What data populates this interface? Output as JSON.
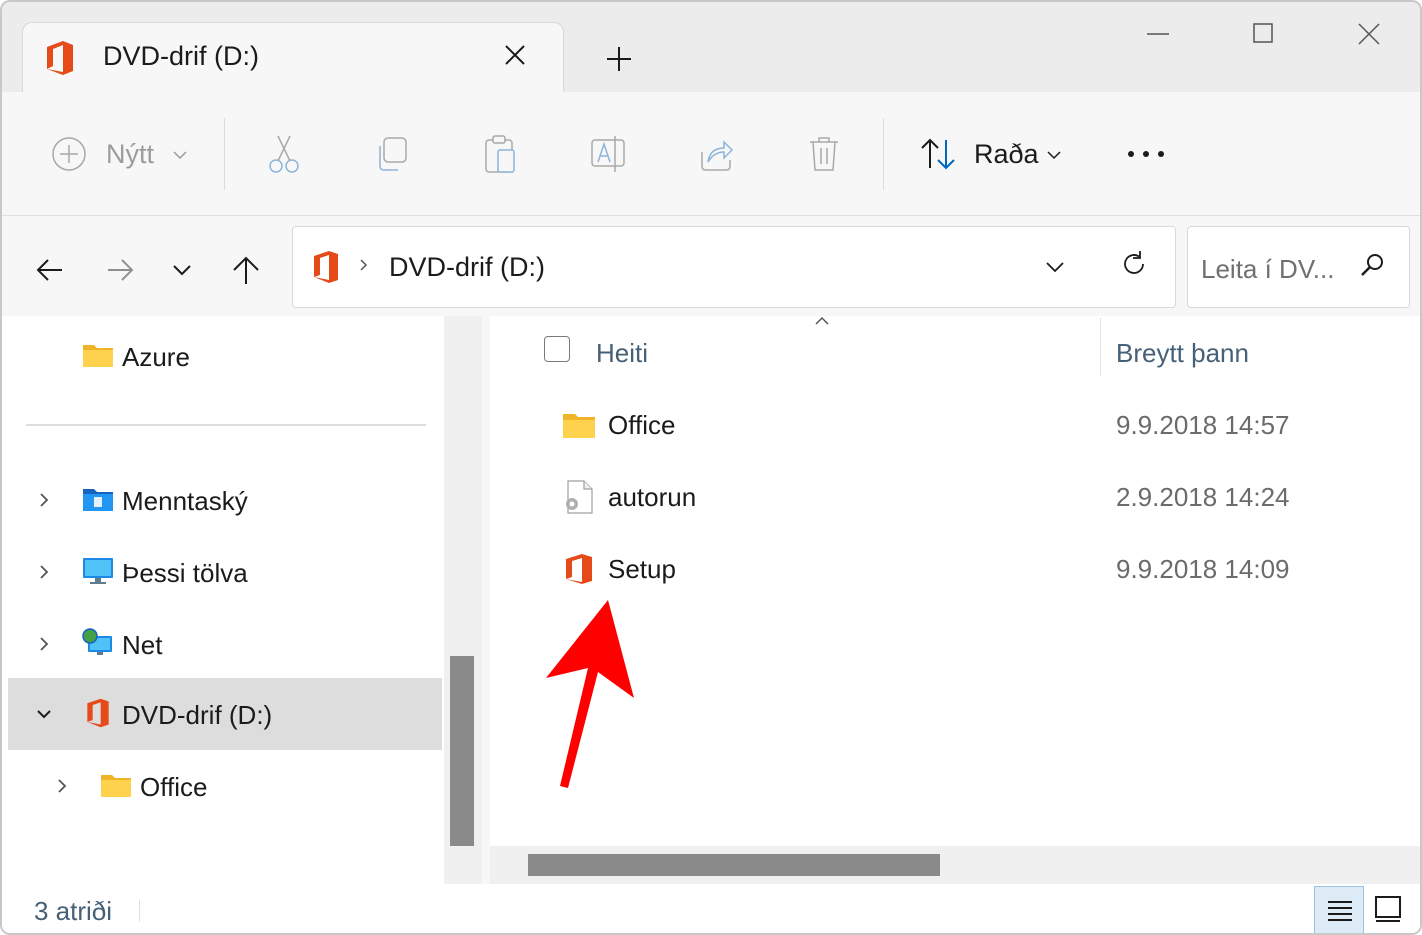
{
  "window": {
    "tab_title": "DVD-drif (D:)"
  },
  "toolbar": {
    "new_label": "Nýtt",
    "sort_label": "Raða"
  },
  "address": {
    "path": "DVD-drif (D:)",
    "search_placeholder": "Leita í DV..."
  },
  "sidebar": {
    "items": [
      {
        "label": "Azure",
        "icon": "folder-icon"
      },
      {
        "label": "Menntaský",
        "icon": "onedrive-folder-icon"
      },
      {
        "label": "Þessi tölva",
        "icon": "computer-icon"
      },
      {
        "label": "Net",
        "icon": "network-icon"
      },
      {
        "label": "DVD-drif (D:)",
        "icon": "office-icon"
      },
      {
        "label": "Office",
        "icon": "folder-icon"
      }
    ]
  },
  "list": {
    "col_name": "Heiti",
    "col_date": "Breytt þann",
    "rows": [
      {
        "name": "Office",
        "date": "9.9.2018 14:57",
        "icon": "folder-icon"
      },
      {
        "name": "autorun",
        "date": "2.9.2018 14:24",
        "icon": "settings-file-icon"
      },
      {
        "name": "Setup",
        "date": "9.9.2018 14:09",
        "icon": "office-icon"
      }
    ]
  },
  "status": {
    "count_text": "3 atriði"
  },
  "colors": {
    "office_red": "#e64a19",
    "folder_yellow": "#ffd24d",
    "header_text": "#466177",
    "annotation_arrow": "#ff0000"
  }
}
